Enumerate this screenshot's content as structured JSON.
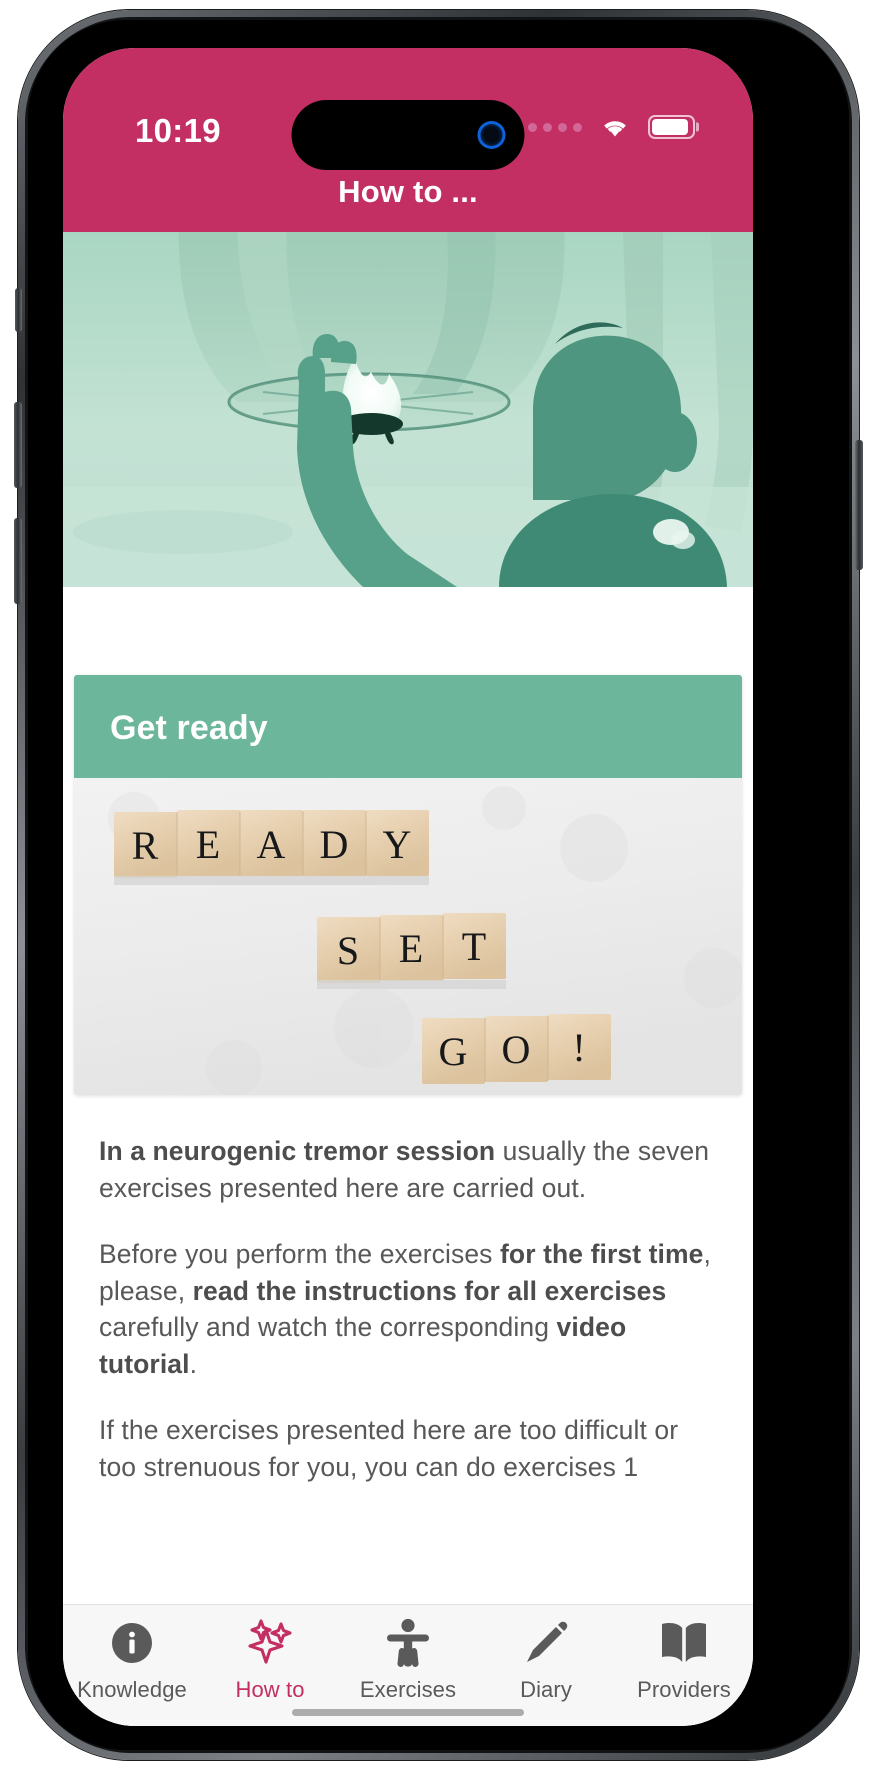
{
  "status_bar": {
    "time": "10:19",
    "signal_icon": "signal-dots-icon",
    "wifi_icon": "wifi-icon",
    "battery_icon": "battery-icon"
  },
  "header": {
    "title": "How to ...",
    "background_color": "#c32f63"
  },
  "hero": {
    "alt": "child releasing a sky lantern",
    "tint_color": "#6cb79b"
  },
  "card": {
    "title": "Get ready",
    "header_color": "#6cb79b",
    "image_alt": "wooden scrabble tiles spelling READY SET GO!",
    "image_words": [
      "R",
      "E",
      "A",
      "D",
      "Y",
      "S",
      "E",
      "T",
      "G",
      "O",
      "!"
    ]
  },
  "body": {
    "paragraphs": [
      [
        {
          "text": "In a neurogenic tremor session",
          "bold": true
        },
        {
          "text": " usually the seven exercises presented here are carried out.",
          "bold": false
        }
      ],
      [
        {
          "text": "Before you perform the exercises ",
          "bold": false
        },
        {
          "text": "for the first time",
          "bold": true
        },
        {
          "text": ", please, ",
          "bold": false
        },
        {
          "text": "read the instructions for all exercises",
          "bold": true
        },
        {
          "text": " carefully and watch the corresponding ",
          "bold": false
        },
        {
          "text": "video tutorial",
          "bold": true
        },
        {
          "text": ".",
          "bold": false
        }
      ],
      [
        {
          "text": "If the exercises presented here are too difficult or too strenuous for you, you can do exercises 1",
          "bold": false
        }
      ]
    ]
  },
  "tabbar": {
    "items": [
      {
        "label": "Knowledge",
        "icon": "info-circle-icon",
        "active": false
      },
      {
        "label": "How to",
        "icon": "sparkles-icon",
        "active": true
      },
      {
        "label": "Exercises",
        "icon": "person-icon",
        "active": false
      },
      {
        "label": "Diary",
        "icon": "pencil-icon",
        "active": false
      },
      {
        "label": "Providers",
        "icon": "book-icon",
        "active": false
      }
    ],
    "active_color": "#c32f63",
    "inactive_color": "#5a5a5a"
  }
}
